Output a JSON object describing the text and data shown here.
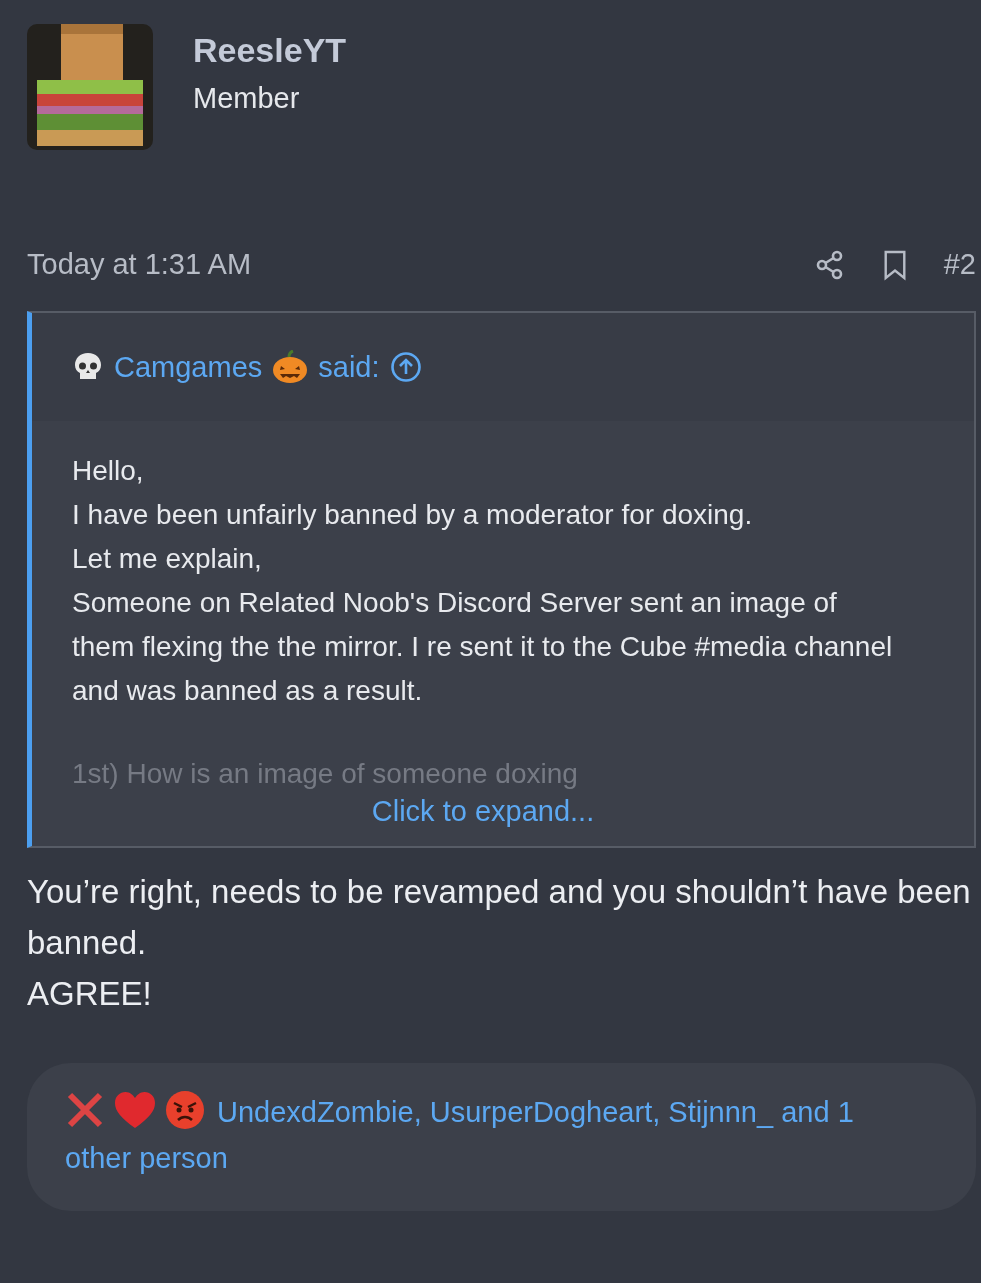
{
  "author": {
    "name": "ReesleYT",
    "role": "Member"
  },
  "post": {
    "time": "Today at 1:31 AM",
    "number": "#2"
  },
  "quote": {
    "author": "Camgames",
    "said": "said:",
    "lines": [
      "Hello,",
      "I have been unfairly banned by a moderator for doxing.",
      "Let me explain,",
      "Someone on Related Noob's Discord Server sent an image of them flexing the the mirror. I re sent it to the Cube #media channel and was banned as a result."
    ],
    "faded_line": "1st) How is an image of someone doxing",
    "expand": "Click to expand..."
  },
  "body": [
    "You’re right, needs to be revamped and you shouldn’t have been banned.",
    "AGREE!"
  ],
  "reactions": {
    "icons": [
      {
        "kind": "cross"
      },
      {
        "kind": "heart"
      },
      {
        "kind": "angry"
      }
    ],
    "text": "UndexdZombie, UsurperDogheart, Stijnnn_ and 1 other person"
  }
}
